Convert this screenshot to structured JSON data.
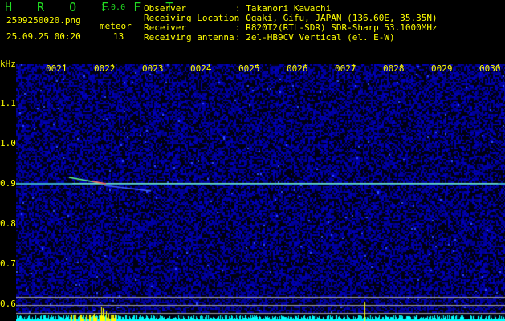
{
  "app": {
    "name": "H R O F F T",
    "version": "1.0.0"
  },
  "file": {
    "name": "2509250020.png",
    "datetime": "25.09.25 00:20"
  },
  "meteor": {
    "label": "meteor",
    "count": "13"
  },
  "info": [
    {
      "label": "Observer",
      "value": ": Takanori Kawachi"
    },
    {
      "label": "Receiving Location",
      "value": ": Ogaki, Gifu, JAPAN (136.60E, 35.35N)"
    },
    {
      "label": "Receiver",
      "value": ": R820T2(RTL-SDR) SDR-Sharp 53.1000MHz"
    },
    {
      "label": "Receiving antenna",
      "value": ": 2el-HB9CV Vertical (el. E-W)"
    }
  ],
  "axis": {
    "y_unit": "kHz",
    "y_ticks": [
      "1.1",
      "1.0",
      "0.9",
      "0.8",
      "0.7",
      "0.6"
    ],
    "x_ticks": [
      "0021",
      "0022",
      "0023",
      "0024",
      "0025",
      "0026",
      "0027",
      "0028",
      "0029",
      "0030"
    ]
  },
  "colors": {
    "text": "#ffff00",
    "title": "#22dd22",
    "carrier": "#44ddcc",
    "histogram": "#00ffff",
    "meteor_spike": "#ffff00"
  }
}
